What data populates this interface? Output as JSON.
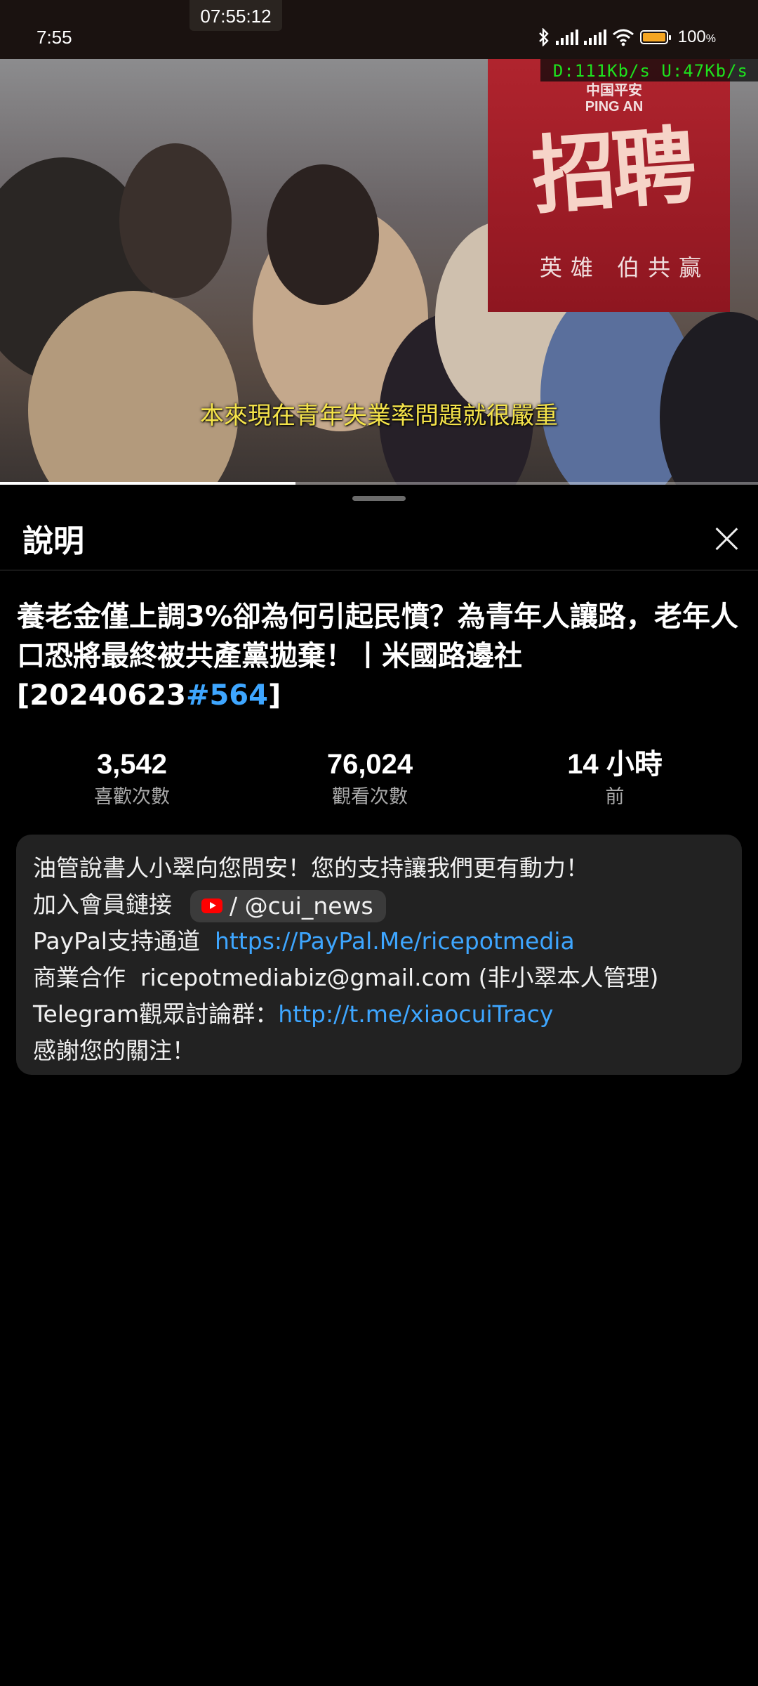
{
  "status_bar": {
    "time": "7:55",
    "clock_overlay": "07:55:12",
    "battery": "100",
    "battery_unit": "%",
    "net_download": "D:111Kb/s",
    "net_upload": "U:47Kb/s"
  },
  "video": {
    "subtitle": "本來現在青年失業率問題就很嚴重",
    "banner_logo": "中国平安\nPING AN",
    "banner_main": "招聘",
    "banner_sub": "英雄 伯共赢",
    "progress_fraction": 0.39
  },
  "sheet": {
    "title": "說明",
    "video_title_text": "養老金僅上調3%卻為何引起民憤？為青年人讓路，老年人口恐將最終被共產黨拋棄！丨米國路邊社[20240623",
    "video_title_hashtag": "#564",
    "video_title_end": "]",
    "stats": [
      {
        "value": "3,542",
        "label": "喜歡次數"
      },
      {
        "value": "76,024",
        "label": "觀看次數"
      },
      {
        "value": "14 小時",
        "label": "前"
      }
    ],
    "description": {
      "line1": "油管說書人小翠向您問安！您的支持讓我們更有動力！",
      "line2_label": "加入會員鏈接",
      "line2_mention": "/ @cui_news",
      "line3_label": "PayPal支持通道",
      "line3_link": "https://PayPal.Me/ricepotmedia",
      "line4": "商業合作  ricepotmediabiz@gmail.com (非小翠本人管理)",
      "line5_label": "Telegram觀眾討論群：",
      "line5_link": "http://t.me/xiaocuiTracy",
      "line6": "感謝您的關注！"
    }
  },
  "colors": {
    "link": "#3ea6ff",
    "subtitle": "#f4e34a",
    "net_speed": "#1ee21e",
    "battery": "#f5a623",
    "youtube_red": "#ff0000"
  }
}
